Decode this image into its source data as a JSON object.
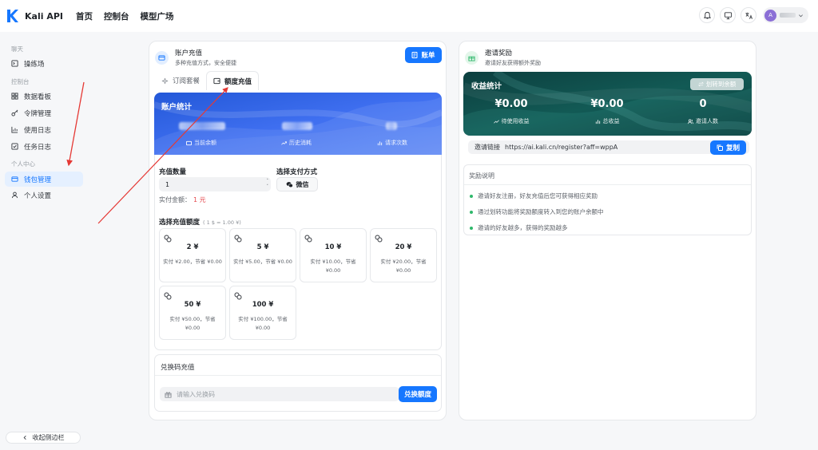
{
  "app": {
    "name": "Kali API"
  },
  "nav": [
    "首页",
    "控制台",
    "模型广场"
  ],
  "user": {
    "avatar_letter": "A"
  },
  "sidebar": {
    "groups": [
      {
        "label": "聊天",
        "items": [
          {
            "label": "操练场",
            "icon": "playground-icon"
          }
        ]
      },
      {
        "label": "控制台",
        "items": [
          {
            "label": "数据看板",
            "icon": "dashboard-icon"
          },
          {
            "label": "令牌管理",
            "icon": "key-icon"
          },
          {
            "label": "使用日志",
            "icon": "chart-icon"
          },
          {
            "label": "任务日志",
            "icon": "task-icon"
          }
        ]
      },
      {
        "label": "个人中心",
        "items": [
          {
            "label": "钱包管理",
            "icon": "wallet-icon",
            "active": true
          },
          {
            "label": "个人设置",
            "icon": "user-icon"
          }
        ]
      }
    ],
    "collapse_label": "收起侧边栏"
  },
  "recharge": {
    "title": "账户充值",
    "subtitle": "多种充值方式，安全便捷",
    "bill_label": "账单",
    "tabs": [
      {
        "label": "订阅套餐",
        "active": false
      },
      {
        "label": "额度充值",
        "active": true
      }
    ],
    "stats": {
      "title": "账户统计",
      "labels": [
        "当前余额",
        "历史消耗",
        "请求次数"
      ]
    },
    "amount_label": "充值数量",
    "amount_value": "1",
    "pay_label": "选择支付方式",
    "pay_method": "微信",
    "actual_label": "实付金额：",
    "actual_value": "1 元",
    "preset_title": "选择充值额度",
    "rate_note": "( 1 $ = 1.00 ¥)",
    "presets": [
      {
        "value": "2 ¥",
        "desc": "实付 ¥2.00，节省 ¥0.00"
      },
      {
        "value": "5 ¥",
        "desc": "实付 ¥5.00，节省 ¥0.00"
      },
      {
        "value": "10 ¥",
        "desc": "实付 ¥10.00，节省 ¥0.00"
      },
      {
        "value": "20 ¥",
        "desc": "实付 ¥20.00，节省 ¥0.00"
      },
      {
        "value": "50 ¥",
        "desc": "实付 ¥50.00，节省 ¥0.00"
      },
      {
        "value": "100 ¥",
        "desc": "实付 ¥100.00，节省 ¥0.00"
      }
    ],
    "redeem": {
      "title": "兑换码充值",
      "placeholder": "请输入兑换码",
      "button": "兑换额度"
    }
  },
  "invite": {
    "title": "邀请奖励",
    "subtitle": "邀请好友获得额外奖励",
    "earnings_title": "收益统计",
    "transfer_label": "划转到余额",
    "stats": [
      {
        "value": "¥0.00",
        "label": "待使用收益",
        "icon": "trend-icon"
      },
      {
        "value": "¥0.00",
        "label": "总收益",
        "icon": "bar-icon"
      },
      {
        "value": "0",
        "label": "邀请人数",
        "icon": "users-icon"
      }
    ],
    "link_label": "邀请链接",
    "link_url": "https://ai.kali.cn/register?aff=wppA",
    "copy_label": "复制",
    "rules_title": "奖励说明",
    "rules": [
      "邀请好友注册，好友充值后您可获得相应奖励",
      "通过划转功能将奖励额度转入到您的账户余额中",
      "邀请的好友越多，获得的奖励越多"
    ]
  },
  "colors": {
    "accent": "#1677ff",
    "active_bg": "#e5f0ff",
    "banner_blue": "#2b5fe0",
    "banner_teal": "#0f4a4a",
    "amount_red": "#e5484d",
    "rule_dot": "#2fb86b",
    "arrow_red": "#e53935"
  }
}
